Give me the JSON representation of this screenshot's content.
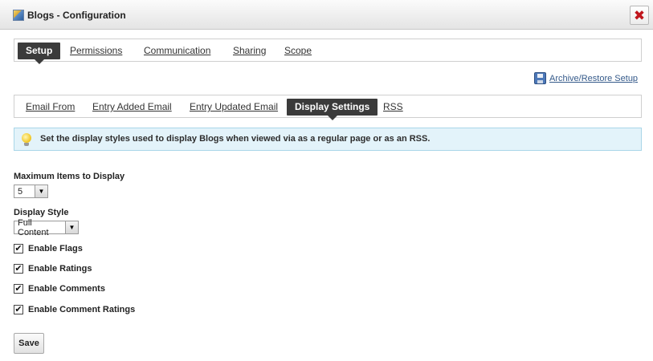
{
  "window": {
    "title": "Blogs - Configuration",
    "close_glyph": "✖"
  },
  "top_tabs": [
    {
      "label": "Setup",
      "active": true
    },
    {
      "label": "Permissions",
      "active": false
    },
    {
      "label": "Communication",
      "active": false
    },
    {
      "label": "Sharing",
      "active": false
    },
    {
      "label": "Scope",
      "active": false
    }
  ],
  "archive": {
    "label": "Archive/Restore Setup",
    "icon": "save-disk-icon"
  },
  "sub_tabs": [
    {
      "label": "Email From",
      "active": false
    },
    {
      "label": "Entry Added Email",
      "active": false
    },
    {
      "label": "Entry Updated Email",
      "active": false
    },
    {
      "label": "Display Settings",
      "active": true
    },
    {
      "label": "RSS",
      "active": false
    }
  ],
  "info": {
    "icon": "lightbulb-icon",
    "text": "Set the display styles used to display Blogs when viewed via as a regular page or as an RSS."
  },
  "form": {
    "max_items_label": "Maximum Items to Display",
    "max_items_value": "5",
    "display_style_label": "Display Style",
    "display_style_value": "Full Content",
    "checkboxes": [
      {
        "label": "Enable Flags",
        "checked": true
      },
      {
        "label": "Enable Ratings",
        "checked": true
      },
      {
        "label": "Enable Comments",
        "checked": true
      },
      {
        "label": "Enable Comment Ratings",
        "checked": true
      }
    ],
    "check_glyph": "✔",
    "save_label": "Save"
  },
  "colors": {
    "active_tab": "#3b3b3b",
    "info_bg": "#e3f3fa",
    "link": "#355a8a",
    "close": "#c0161d"
  }
}
